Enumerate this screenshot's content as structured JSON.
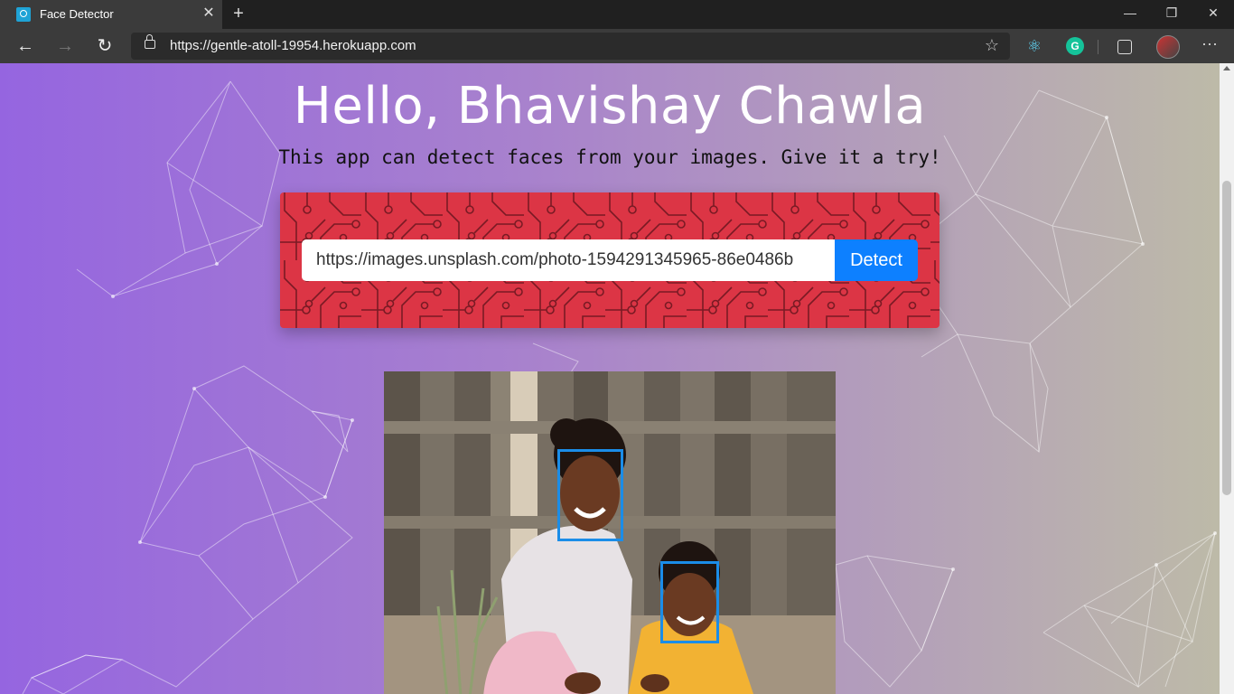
{
  "browser": {
    "tab_title": "Face Detector",
    "url": "https://gentle-atoll-19954.herokuapp.com",
    "tab_close_glyph": "✕",
    "new_tab_glyph": "+",
    "minimize_glyph": "—",
    "restore_glyph": "❐",
    "close_glyph": "✕",
    "back_glyph": "←",
    "forward_glyph": "→",
    "refresh_glyph": "↻",
    "star_glyph": "☆",
    "more_glyph": "···",
    "extensions": [
      "react-devtools-icon",
      "grammarly-icon",
      "collections-icon",
      "profile-avatar"
    ]
  },
  "page": {
    "greeting": "Hello, Bhavishay Chawla",
    "subtitle": "This app can detect faces from your images. Give it a try!",
    "image_url_value": "https://images.unsplash.com/photo-1594291345965-86e0486b",
    "detect_label": "Detect",
    "faces_detected": 2
  },
  "colors": {
    "card_red": "#dc3545",
    "button_blue": "#0d80ff",
    "face_box": "#1b8de8",
    "bg_left": "#9565e0",
    "bg_right": "#bdbaa8"
  }
}
